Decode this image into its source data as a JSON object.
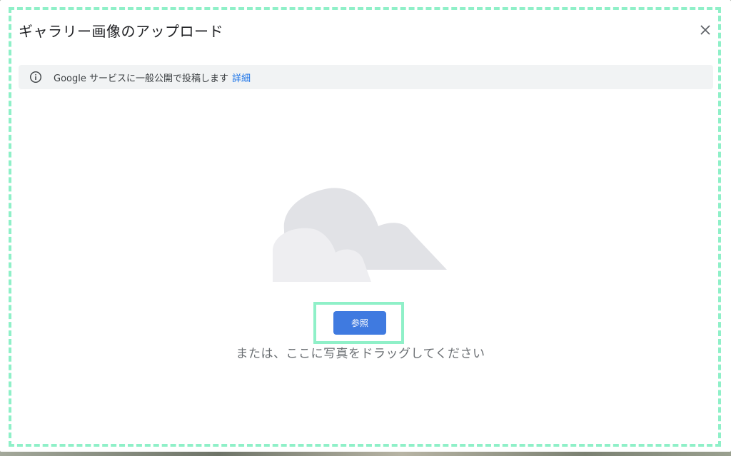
{
  "dialog": {
    "title": "ギャラリー画像のアップロード",
    "close_icon": "close-icon"
  },
  "info_bar": {
    "icon": "info-icon",
    "text": "Google サービスに一般公開で投稿します",
    "link_label": "詳細"
  },
  "upload": {
    "illustration": "cloud-icon",
    "browse_label": "参照",
    "drag_text": "または、ここに写真をドラッグしてください"
  },
  "colors": {
    "accent_button": "#3f7ae0",
    "link": "#1a73e8",
    "highlight": "#8ff0c8"
  }
}
